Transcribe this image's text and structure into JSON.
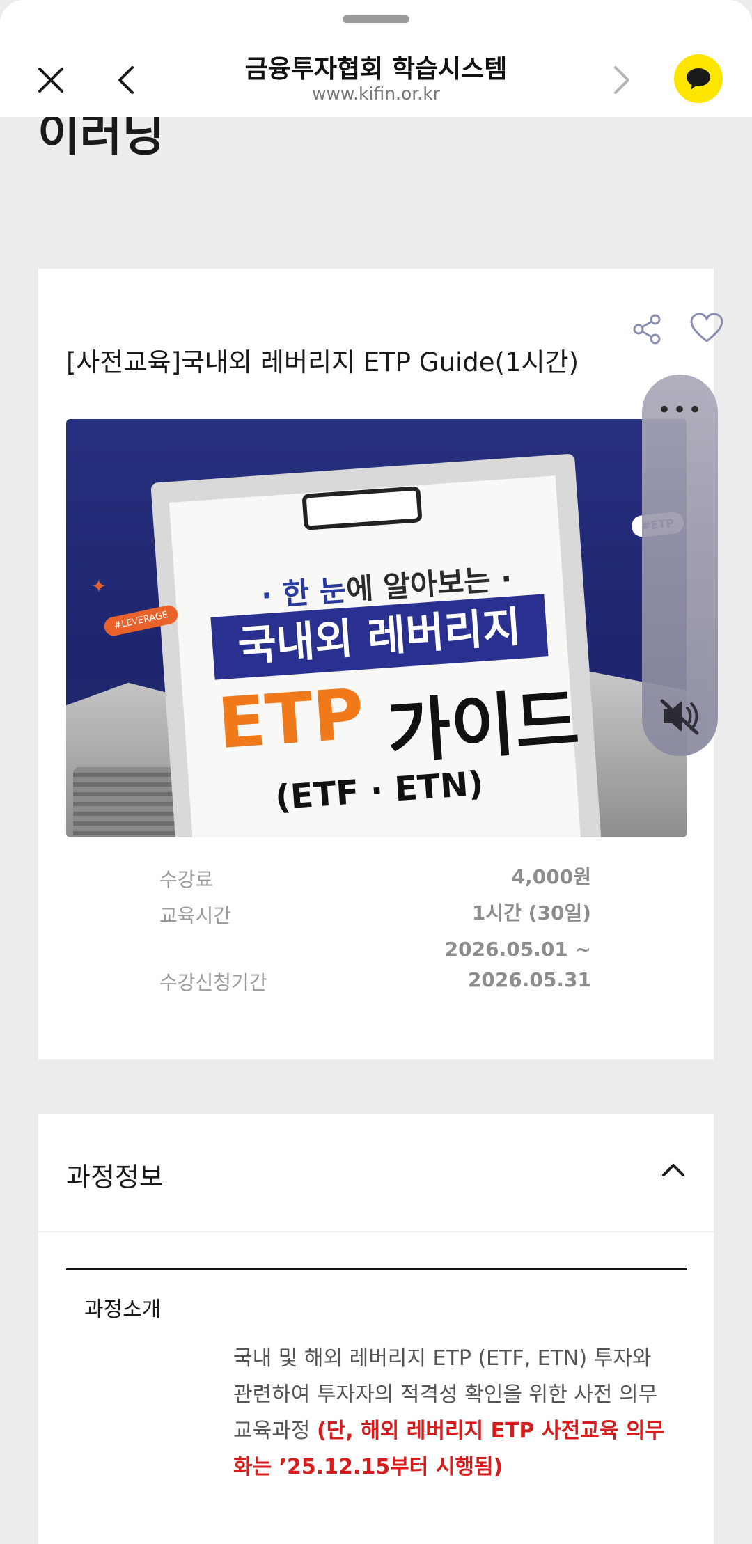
{
  "browser": {
    "title": "금융투자협회 학습시스템",
    "url": "www.kifin.or.kr"
  },
  "page": {
    "heading": "이러닝"
  },
  "course": {
    "title": "[사전교육]국내외 레버리지 ETP Guide(1시간)",
    "banner": {
      "line_top_highlight": "· 한 눈",
      "line_top_rest": "에 알아보는 ·",
      "line_main": "국내외 레버리지",
      "line_etp": "ETP",
      "line_guide": "가이드",
      "line_sub": "(ETF · ETN)",
      "tag_left": "#LEVERAGE",
      "tag_right": "#ETP"
    },
    "info": [
      {
        "label": "수강료",
        "value": "4,000원"
      },
      {
        "label": "교육시간",
        "value": "1시간 (30일)"
      },
      {
        "label": "수강신청기간",
        "value_line1": "2026.05.01 ~",
        "value_line2": "2026.05.31"
      }
    ]
  },
  "section": {
    "title": "과정정보",
    "intro_label": "과정소개",
    "intro_normal": "국내 및 해외 레버리지 ETP (ETF, ETN) 투자와 관련하여 투자자의 적격성 확인을 위한 사전 의무 교육과정 ",
    "intro_red": "(단, 해외 레버리지 ETP 사전교육 의무화는 ’25.12.15부터 시행됨)"
  },
  "colors": {
    "kakao_yellow": "#fee500",
    "notice_red": "#d81b1b",
    "banner_navy": "#27307e",
    "banner_orange": "#f07a1a"
  }
}
